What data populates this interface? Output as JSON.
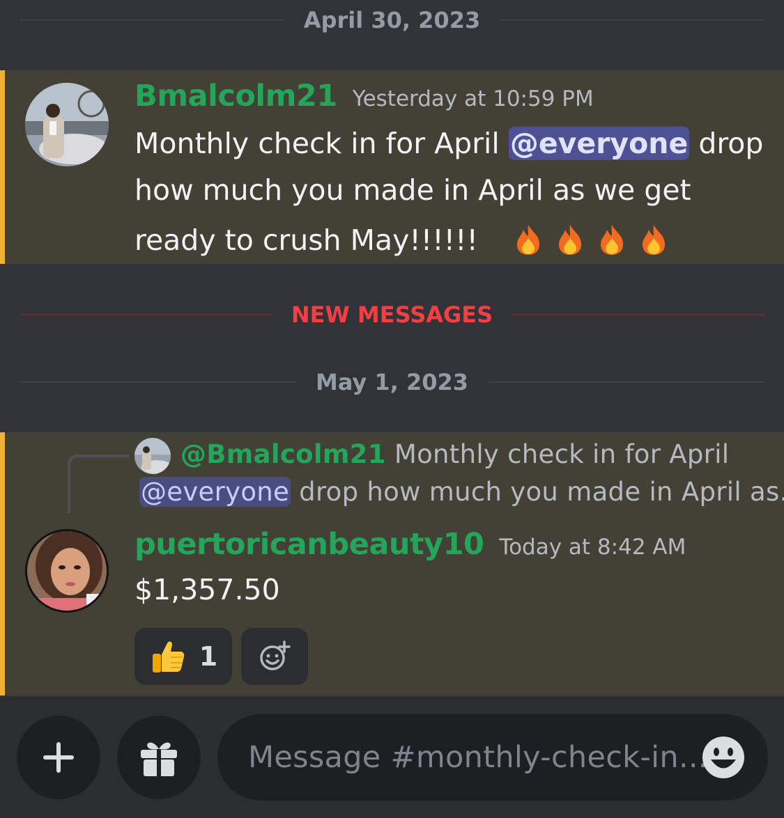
{
  "dividers": {
    "date1": "April 30, 2023",
    "new_messages": "NEW MESSAGES",
    "date2": "May 1, 2023"
  },
  "message1": {
    "username": "Bmalcolm21",
    "timestamp": "Yesterday at 10:59 PM",
    "text_before": "Monthly check in for April ",
    "mention": "@everyone",
    "text_after_line1": " drop",
    "line2": "how much you made in April as we get",
    "line3": "ready to crush May!!!!!!",
    "emoji": [
      "fire-emoji",
      "fire-emoji",
      "fire-emoji",
      "fire-emoji"
    ]
  },
  "message2": {
    "reply": {
      "username": "@Bmalcolm21",
      "text_line1": "Monthly check in for April",
      "mention": "@everyone",
      "text_line2": " drop how much you made in April as..."
    },
    "username": "puertoricanbeauty10",
    "timestamp": "Today at 8:42 AM",
    "text": "$1,357.50",
    "reaction": {
      "emoji": "thumbs-up-emoji",
      "count": "1"
    }
  },
  "composer": {
    "placeholder": "Message #monthly-check-in...",
    "icons": [
      "plus-icon",
      "gift-icon",
      "smiley-icon",
      "add-reaction-icon"
    ]
  },
  "colors": {
    "background": "#313338",
    "highlight": "#434036",
    "highlight_border": "#f0b232",
    "username": "#23a55a",
    "new_messages": "#f23f43",
    "mention_bg": "#4e5295"
  }
}
